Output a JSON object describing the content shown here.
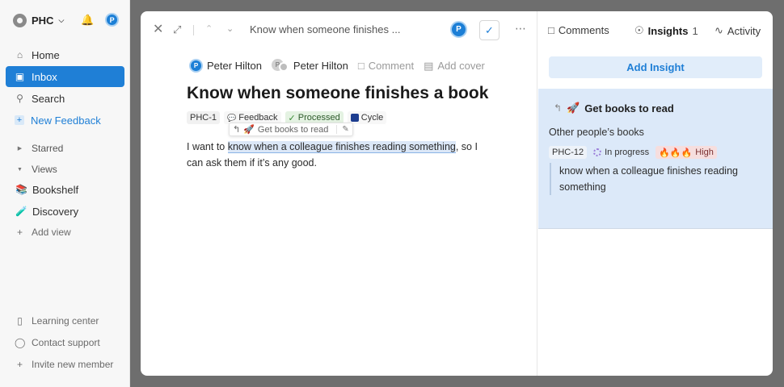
{
  "workspace": {
    "name": "PHC"
  },
  "user": {
    "initial": "P"
  },
  "sidebar": {
    "items": [
      {
        "label": "Home",
        "icon": "home-icon"
      },
      {
        "label": "Inbox",
        "icon": "inbox-icon"
      },
      {
        "label": "Search",
        "icon": "search-icon"
      },
      {
        "label": "New Feedback",
        "icon": "plus-icon"
      }
    ],
    "starred_label": "Starred",
    "views_label": "Views",
    "views": [
      {
        "label": "Bookshelf",
        "emoji": "📚"
      },
      {
        "label": "Discovery",
        "emoji": "🧪"
      }
    ],
    "add_view_label": "Add view",
    "footer": [
      {
        "label": "Learning center"
      },
      {
        "label": "Contact support"
      },
      {
        "label": "Invite new member"
      }
    ]
  },
  "modal": {
    "breadcrumb_title": "Know when someone finishes ...",
    "assignee_initial": "P",
    "people": [
      {
        "name": "Peter Hilton",
        "initial": "P"
      },
      {
        "name": "Peter Hilton",
        "initial": "P"
      }
    ],
    "comment_label": "Comment",
    "add_cover_label": "Add cover",
    "title": "Know when someone finishes a book",
    "chips": {
      "id": "PHC-1",
      "type": "Feedback",
      "status": "Processed",
      "cycle": "Cycle"
    },
    "tooltip": {
      "emoji": "🚀",
      "label": "Get books to read"
    },
    "body": {
      "before": "I want to ",
      "highlight": "know when a colleague finishes reading something",
      "after": ", so I can ask them if it’s any good."
    }
  },
  "right_pane": {
    "tabs": [
      {
        "label": "Comments",
        "icon": "comment-icon"
      },
      {
        "label": "Insights",
        "count": "1",
        "icon": "lightbulb-icon"
      },
      {
        "label": "Activity",
        "icon": "activity-icon"
      }
    ],
    "add_insight_label": "Add Insight",
    "insight": {
      "emoji": "🚀",
      "title": "Get books to read",
      "subtitle": "Other people’s books",
      "id": "PHC-12",
      "status": "In progress",
      "priority_emoji": "🔥🔥🔥",
      "priority": "High",
      "quote": "know when a colleague finishes reading something"
    }
  },
  "colors": {
    "accent": "#1f7fd6",
    "insight_card_bg": "#dce9f9",
    "highlight_bg": "#dbe7f7",
    "processed_bg": "#e4f2e2",
    "high_bg": "#f6dede"
  }
}
